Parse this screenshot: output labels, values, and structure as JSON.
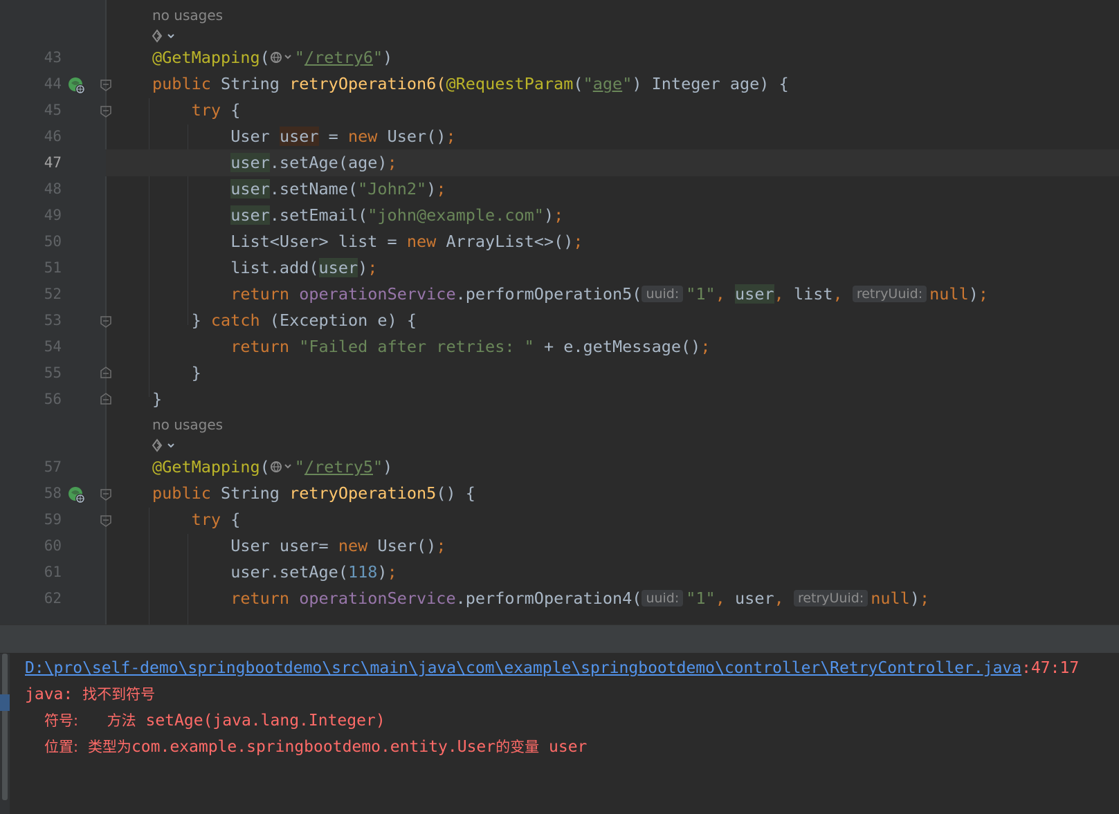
{
  "editor": {
    "usages_label": "no usages",
    "block1": {
      "lines": [
        "43",
        "44",
        "45",
        "46",
        "47",
        "48",
        "49",
        "50",
        "51",
        "52",
        "53",
        "54",
        "55",
        "56"
      ],
      "ann_name": "@GetMapping",
      "path": "/retry6",
      "public": "public",
      "string_type": "String",
      "method": "retryOperation6",
      "req_ann": "@RequestParam",
      "age_param": "age",
      "integer_type": "Integer",
      "age_name": "age",
      "try": "try",
      "user_type": "User",
      "user_var": "user",
      "new": "new",
      "set_age": ".setAge(age)",
      "set_name": ".setName(",
      "name_val": "\"John2\"",
      "set_email": ".setEmail(",
      "email_val": "\"john@example.com\"",
      "list_decl": "List<User> list = ",
      "arraylist": "ArrayList<>()",
      "list_add": "list.add(",
      "return": "return",
      "service": "operationService",
      "perform5": ".performOperation5(",
      "hint_uuid": "uuid:",
      "one": "\"1\"",
      "list_arg": "list",
      "hint_retry": "retryUuid:",
      "null": "null",
      "catch": "catch",
      "exception": "(Exception e) {",
      "failed": "\"Failed after retries: \"",
      "get_message": " + e.getMessage()"
    },
    "block2": {
      "lines": [
        "57",
        "58",
        "59",
        "60",
        "61",
        "62"
      ],
      "path": "/retry5",
      "method": "retryOperation5",
      "user_decl": "User user= ",
      "set_age_num": "118",
      "perform4": ".performOperation4("
    }
  },
  "console": {
    "path": "D:\\pro\\self-demo\\springbootdemo\\src\\main\\java\\com\\example\\springbootdemo\\controller\\RetryController.java",
    "position": ":47:17",
    "java_label": "java: ",
    "error_msg": "找不到符号",
    "symbol_label": "符号:",
    "method_label": "方法",
    "symbol_value": "setAge(java.lang.Integer)",
    "location_label": "位置:",
    "location_prefix": "类型为",
    "location_class": "com.example.springbootdemo.entity.User",
    "location_suffix": "的变量",
    "location_var": "user"
  }
}
